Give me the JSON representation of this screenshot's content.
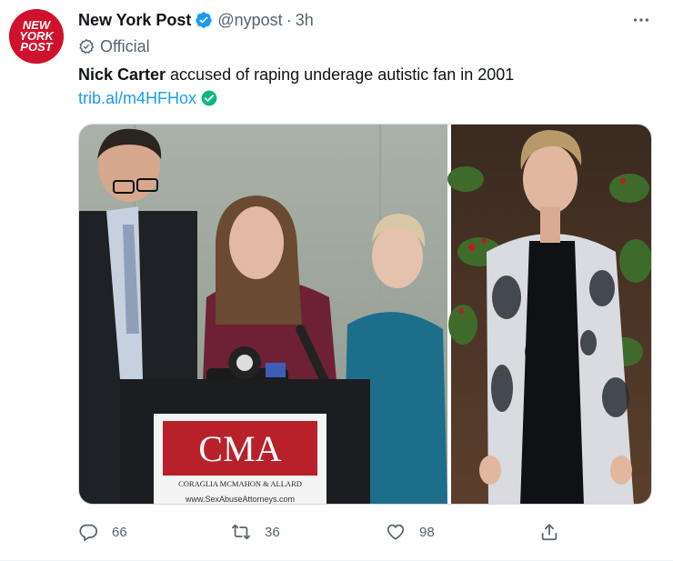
{
  "tweet": {
    "author": {
      "display_name": "New York Post",
      "handle": "@nypost",
      "separator": "·",
      "time": "3h",
      "avatar_lines": [
        "NEW",
        "YORK",
        "POST"
      ],
      "label": "Official"
    },
    "text_bold": "Nick Carter",
    "text_rest": " accused of raping underage autistic fan in 2001",
    "link": "trib.al/m4HFHox",
    "media": {
      "sign_logo": "CMA",
      "sign_firm": "CORAGLIA MCMAHON & ALLARD",
      "sign_url": "www.SexAbuseAttorneys.com"
    },
    "actions": {
      "replies": "66",
      "retweets": "36",
      "likes": "98"
    }
  },
  "colors": {
    "brand_red": "#d0112b",
    "verified_blue": "#1d9bf0",
    "link_blue": "#1d9bf0",
    "link_check_green": "#00ba7c",
    "muted": "#536471"
  },
  "icons": [
    "verified-badge-icon",
    "more-icon",
    "official-badge-icon",
    "link-check-icon",
    "reply-icon",
    "retweet-icon",
    "like-icon",
    "share-icon"
  ]
}
